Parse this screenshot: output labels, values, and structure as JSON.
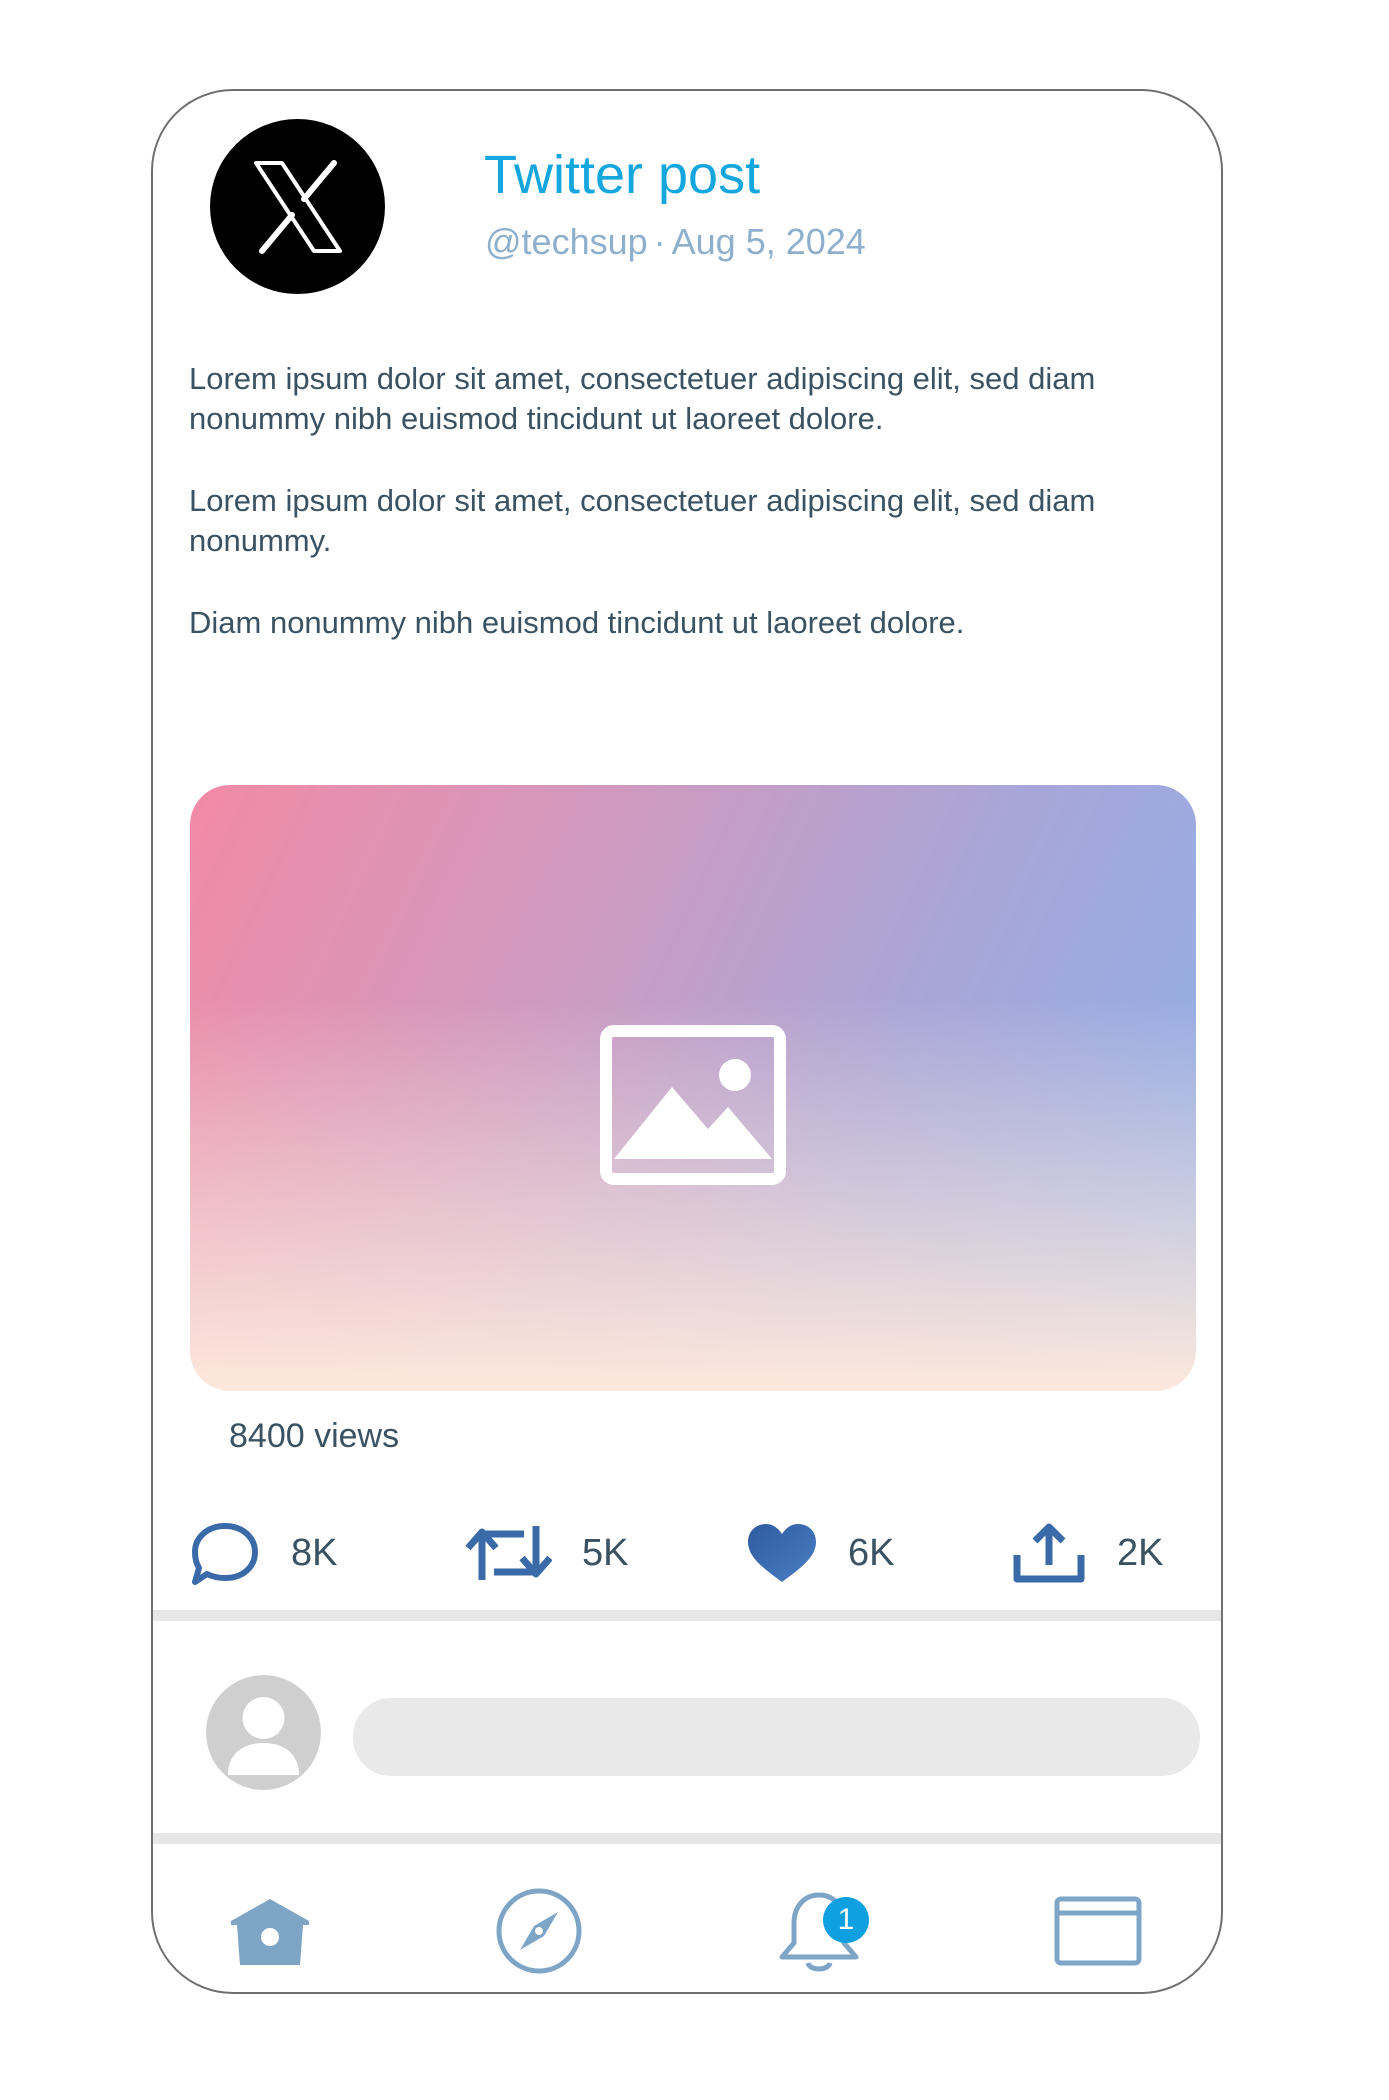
{
  "post": {
    "title": "Twitter post",
    "handle": "@techsup",
    "separator": "·",
    "date": "Aug 5, 2024",
    "paragraphs": [
      "Lorem ipsum dolor sit amet, consectetuer adipiscing elit, sed diam nonummy nibh euismod tincidunt ut laoreet dolore.",
      "Lorem ipsum dolor sit amet, consectetuer adipiscing elit, sed diam nonummy.",
      "Diam nonummy nibh euismod tincidunt ut laoreet dolore."
    ],
    "views": "8400 views"
  },
  "actions": {
    "reply_count": "8K",
    "retweet_count": "5K",
    "like_count": "6K",
    "share_count": "2K"
  },
  "nav": {
    "notification_badge": "1"
  },
  "icons": {
    "logo": "x-logo-icon",
    "media": "image-placeholder-icon",
    "reply": "comment-bubble-icon",
    "retweet": "retweet-icon",
    "like": "heart-icon",
    "share": "share-upload-icon",
    "home": "home-icon",
    "explore": "compass-icon",
    "notifications": "bell-icon",
    "messages": "mail-icon"
  },
  "colors": {
    "title": "#16a6de",
    "meta": "#8fb0cc",
    "text": "#3b5262",
    "action_icons": "#3a6aa8",
    "nav_icons": "#7fa5c6",
    "badge": "#0fa0e2"
  }
}
